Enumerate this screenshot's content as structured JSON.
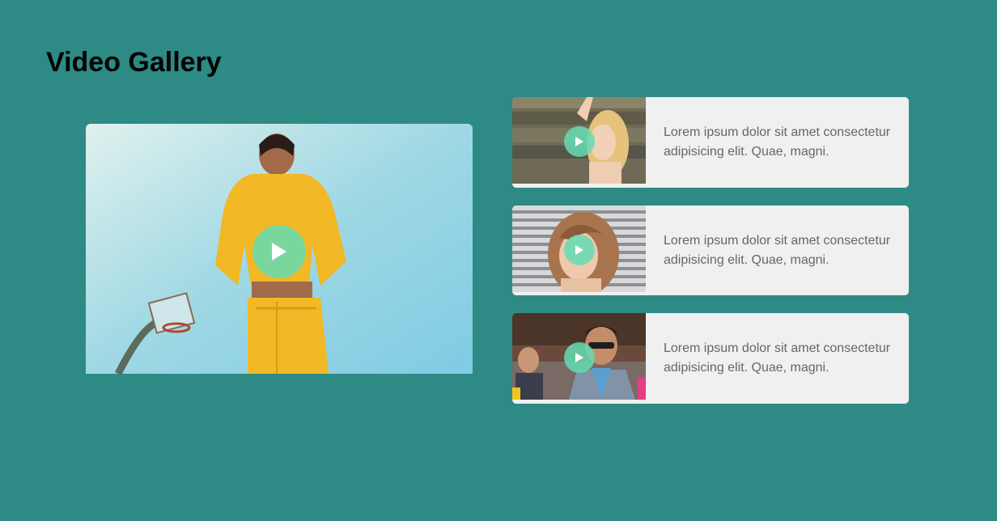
{
  "page": {
    "title": "Video Gallery",
    "background_color": "#2e8a85"
  },
  "main_video": {
    "play_icon": "play-icon"
  },
  "playlist": [
    {
      "description": "Lorem ipsum dolor sit amet consectetur adipisicing elit. Quae, magni."
    },
    {
      "description": "Lorem ipsum dolor sit amet consectetur adipisicing elit. Quae, magni."
    },
    {
      "description": "Lorem ipsum dolor sit amet consectetur adipisicing elit. Quae, magni."
    }
  ],
  "colors": {
    "play_button": "#64dcb4",
    "card_background": "#f0f0f0",
    "description_text": "#666666"
  }
}
